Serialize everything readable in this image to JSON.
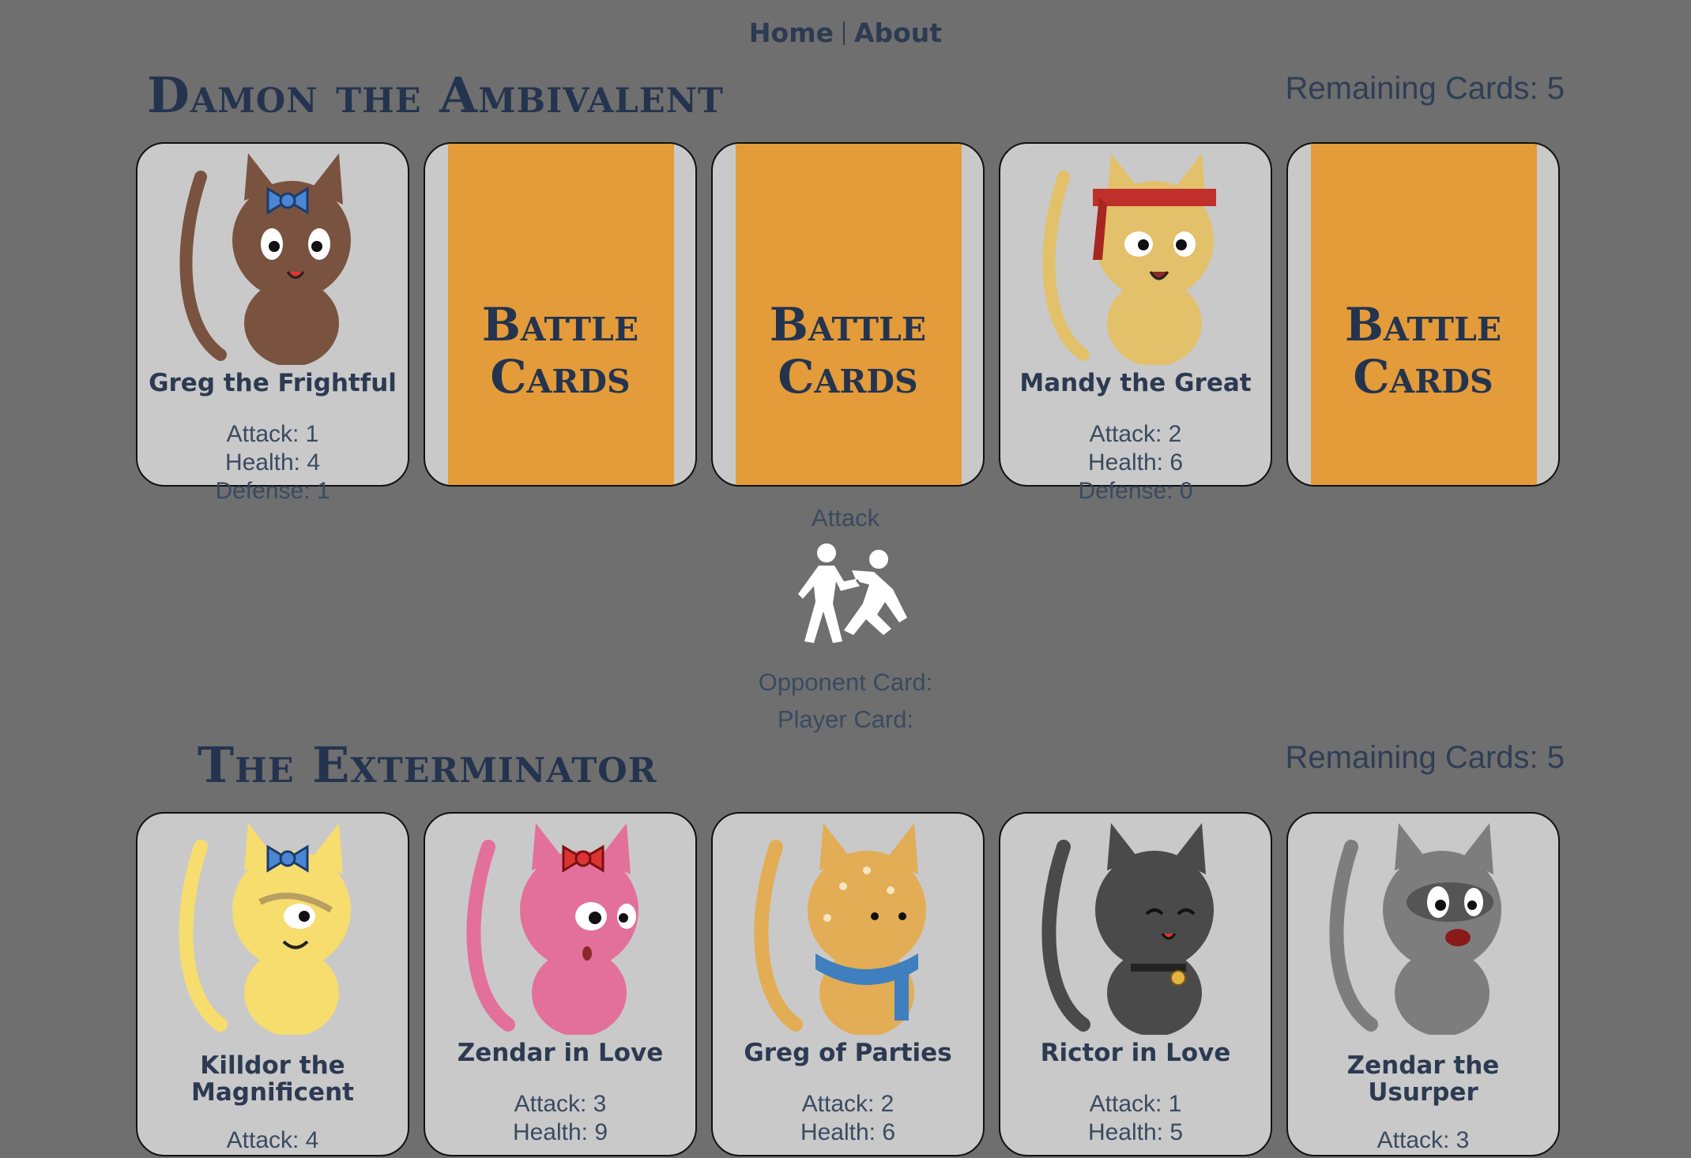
{
  "nav": {
    "home": "Home",
    "about": "About"
  },
  "opponent": {
    "name": "Damon the Ambivalent",
    "remaining": "Remaining Cards: 5",
    "cards": [
      {
        "face": "up",
        "name": "Greg the Frightful",
        "attack": "Attack: 1",
        "health": "Health: 4",
        "defense": "Defense: 1",
        "color": "#7a5240",
        "accessory": "blue-bow"
      },
      {
        "face": "down",
        "back_line1": "Battle",
        "back_line2": "Cards"
      },
      {
        "face": "down",
        "back_line1": "Battle",
        "back_line2": "Cards"
      },
      {
        "face": "up",
        "name": "Mandy the Great",
        "attack": "Attack: 2",
        "health": "Health: 6",
        "defense": "Defense: 0",
        "color": "#e3c06a",
        "accessory": "red-headband"
      },
      {
        "face": "down",
        "back_line1": "Battle",
        "back_line2": "Cards"
      }
    ]
  },
  "battle": {
    "attack_label": "Attack",
    "attack_icon": "attack-icon",
    "opponent_card": "Opponent Card:",
    "player_card": "Player Card:"
  },
  "player": {
    "name": "The Exterminator",
    "remaining": "Remaining Cards: 5",
    "cards": [
      {
        "name_line1": "Killdor the",
        "name_line2": "Magnificent",
        "attack": "Attack: 4",
        "color": "#f6dd6e",
        "accessory": "blue-bow"
      },
      {
        "name_line1": "Zendar in Love",
        "attack": "Attack: 3",
        "health": "Health: 9",
        "color": "#e3709a",
        "accessory": "red-bow"
      },
      {
        "name_line1": "Greg of Parties",
        "attack": "Attack: 2",
        "health": "Health: 6",
        "color": "#e2ad55",
        "accessory": "blue-scarf"
      },
      {
        "name_line1": "Rictor in Love",
        "attack": "Attack: 1",
        "health": "Health: 5",
        "color": "#4a4a4a",
        "accessory": "collar-bell"
      },
      {
        "name_line1": "Zendar the",
        "name_line2": "Usurper",
        "attack": "Attack: 3",
        "color": "#7d7d7d",
        "accessory": "none"
      }
    ]
  }
}
